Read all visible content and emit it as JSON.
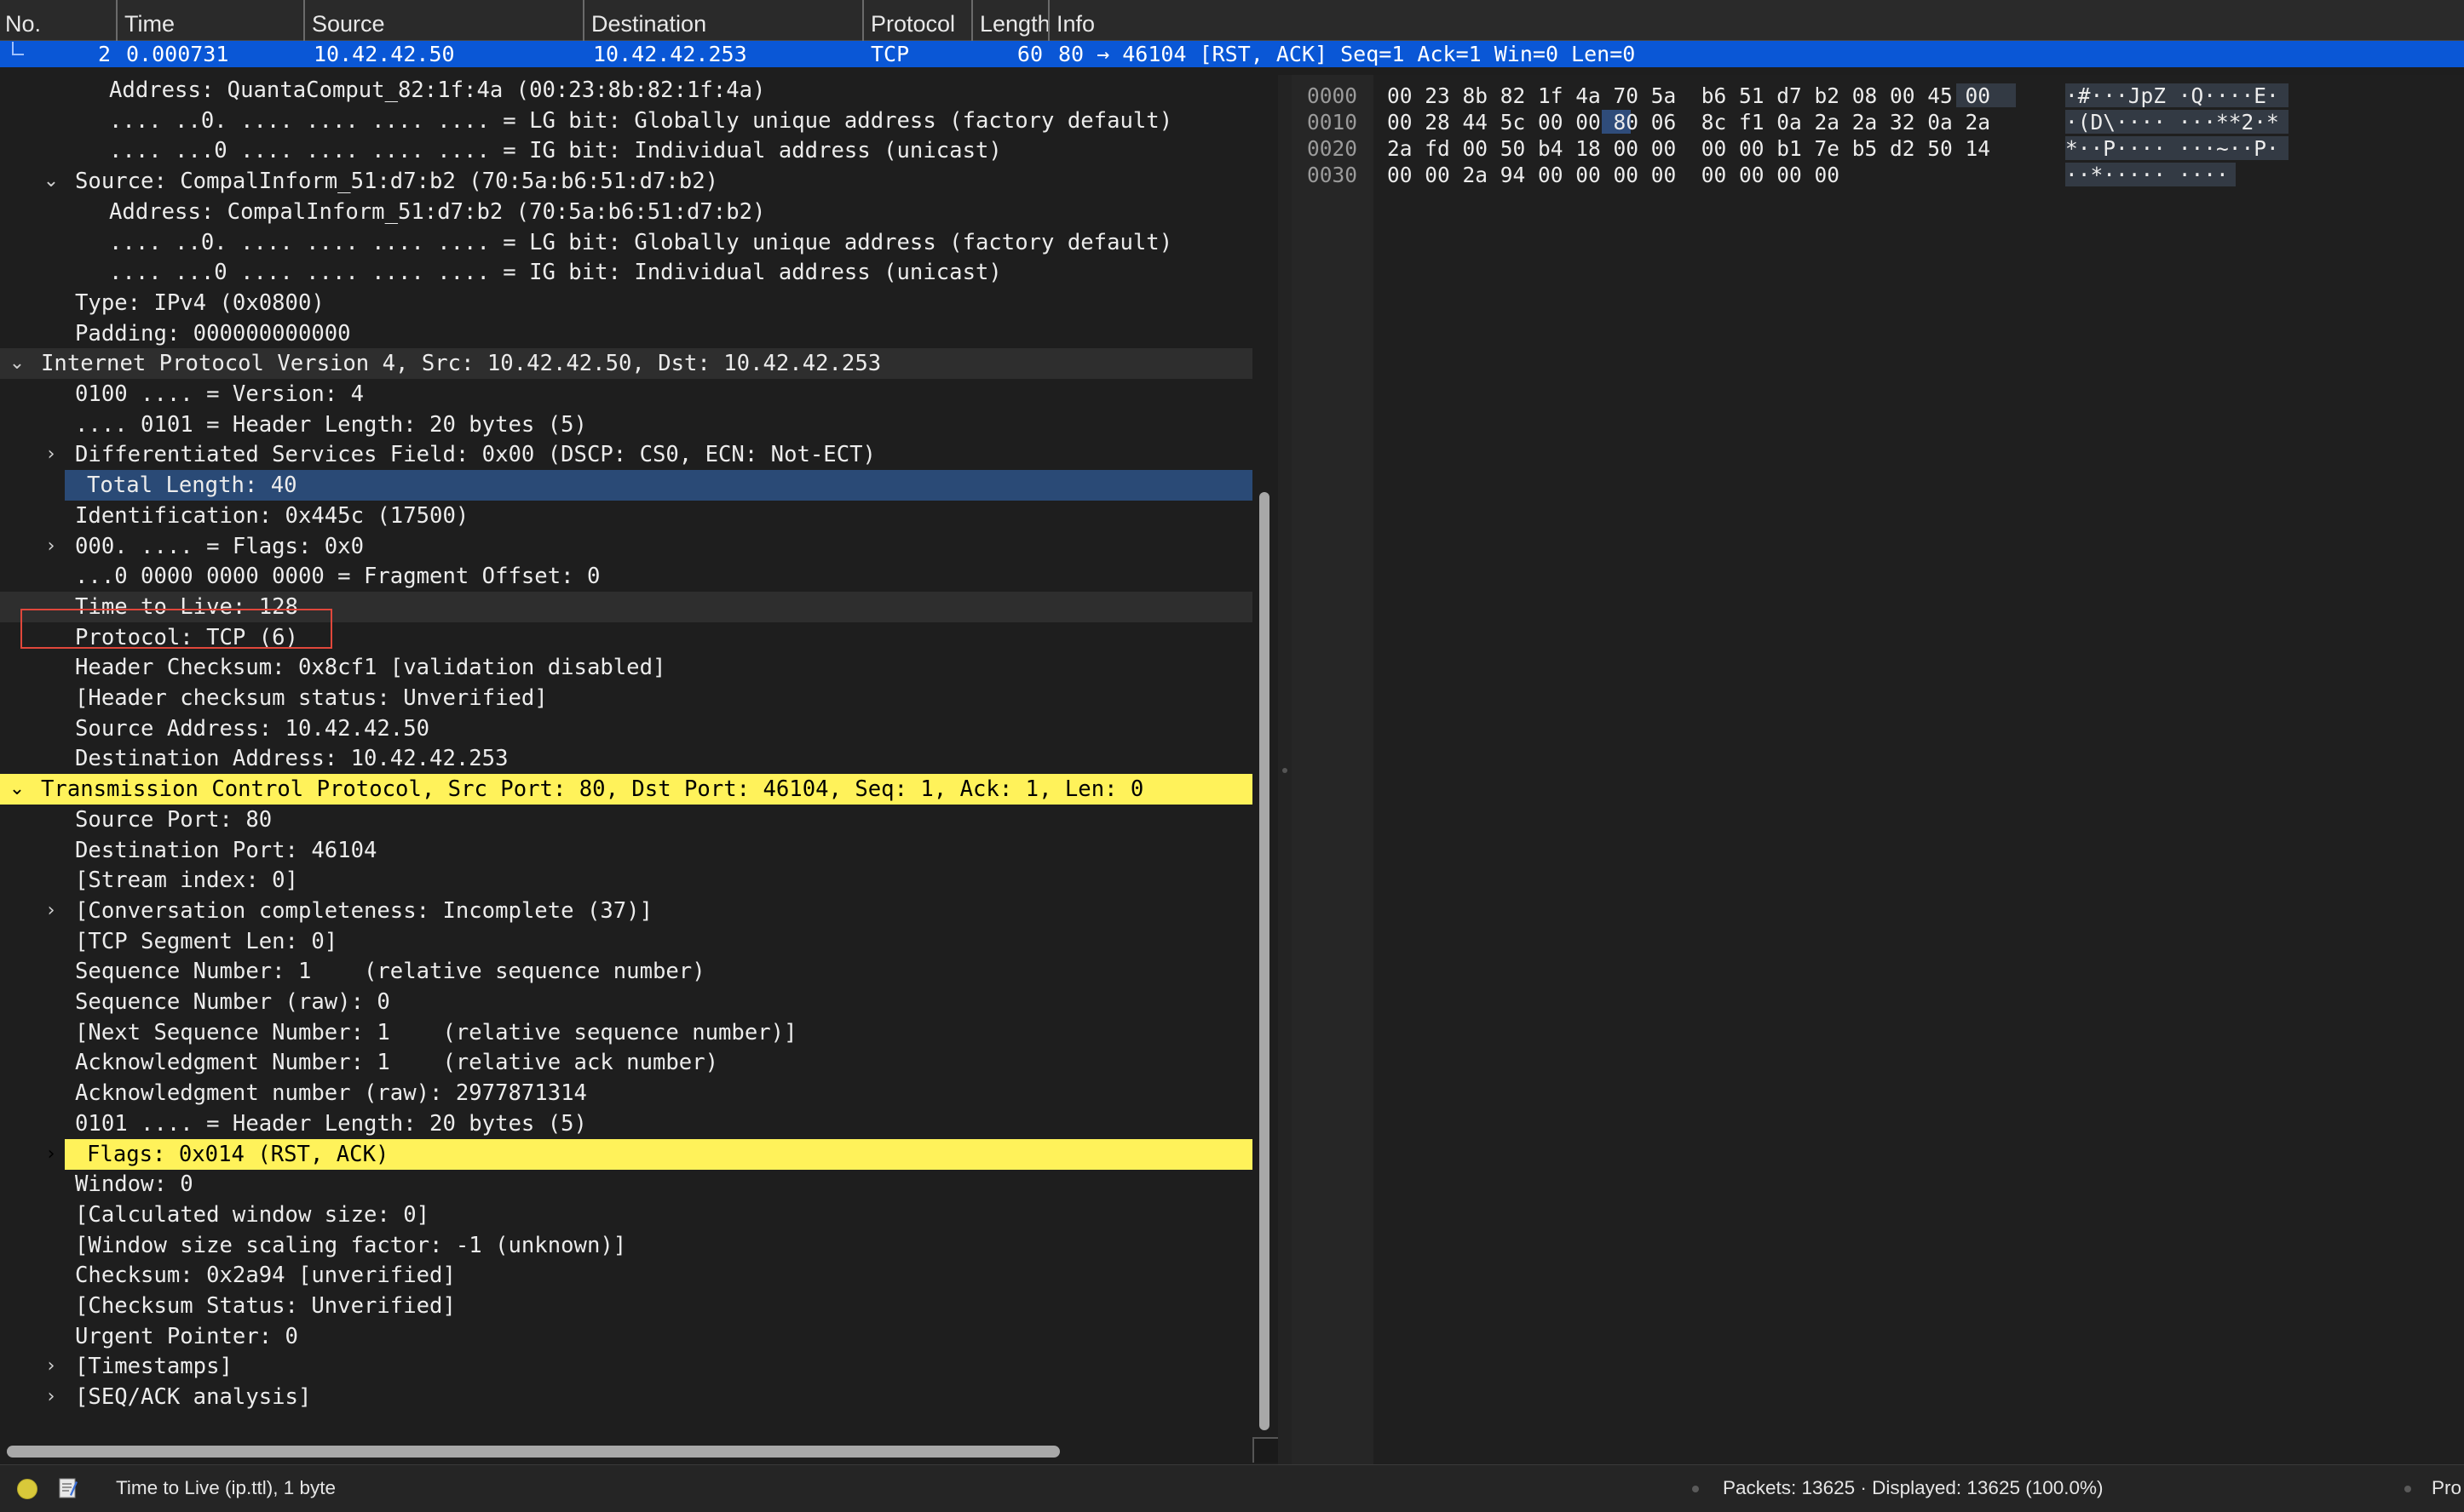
{
  "packet_list": {
    "columns": [
      "No.",
      "Time",
      "Source",
      "Destination",
      "Protocol",
      "Length",
      "Info"
    ],
    "selected_row": {
      "no": "2",
      "time": "0.000731",
      "source": "10.42.42.50",
      "destination": "10.42.42.253",
      "protocol": "TCP",
      "length": "60",
      "info": "80 → 46104 [RST, ACK] Seq=1 Ack=1 Win=0 Len=0"
    }
  },
  "details": {
    "rows": [
      "Address: QuantaComput_82:1f:4a (00:23:8b:82:1f:4a)",
      ".... ..0. .... .... .... .... = LG bit: Globally unique address (factory default)",
      ".... ...0 .... .... .... .... = IG bit: Individual address (unicast)",
      "Source: CompalInform_51:d7:b2 (70:5a:b6:51:d7:b2)",
      "Address: CompalInform_51:d7:b2 (70:5a:b6:51:d7:b2)",
      ".... ..0. .... .... .... .... = LG bit: Globally unique address (factory default)",
      ".... ...0 .... .... .... .... = IG bit: Individual address (unicast)",
      "Type: IPv4 (0x0800)",
      "Padding: 000000000000",
      "Internet Protocol Version 4, Src: 10.42.42.50, Dst: 10.42.42.253",
      "0100 .... = Version: 4",
      ".... 0101 = Header Length: 20 bytes (5)",
      "Differentiated Services Field: 0x00 (DSCP: CS0, ECN: Not-ECT)",
      "Total Length: 40",
      "Identification: 0x445c (17500)",
      "000. .... = Flags: 0x0",
      "...0 0000 0000 0000 = Fragment Offset: 0",
      "Time to Live: 128",
      "Protocol: TCP (6)",
      "Header Checksum: 0x8cf1 [validation disabled]",
      "[Header checksum status: Unverified]",
      "Source Address: 10.42.42.50",
      "Destination Address: 10.42.42.253",
      "Transmission Control Protocol, Src Port: 80, Dst Port: 46104, Seq: 1, Ack: 1, Len: 0",
      "Source Port: 80",
      "Destination Port: 46104",
      "[Stream index: 0]",
      "[Conversation completeness: Incomplete (37)]",
      "[TCP Segment Len: 0]",
      "Sequence Number: 1    (relative sequence number)",
      "Sequence Number (raw): 0",
      "[Next Sequence Number: 1    (relative sequence number)]",
      "Acknowledgment Number: 1    (relative ack number)",
      "Acknowledgment number (raw): 2977871314",
      "0101 .... = Header Length: 20 bytes (5)",
      "Flags: 0x014 (RST, ACK)",
      "Window: 0",
      "[Calculated window size: 0]",
      "[Window size scaling factor: -1 (unknown)]",
      "Checksum: 0x2a94 [unverified]",
      "[Checksum Status: Unverified]",
      "Urgent Pointer: 0",
      "[Timestamps]",
      "[SEQ/ACK analysis]"
    ],
    "arrows": {
      "expanded": "⌄",
      "collapsed": "›"
    }
  },
  "bytes": {
    "offsets": [
      "0000",
      "0010",
      "0020",
      "0030"
    ],
    "hex": [
      "00 23 8b 82 1f 4a 70 5a  b6 51 d7 b2 08 00 45 00",
      "00 28 44 5c 00 00 80 06  8c f1 0a 2a 2a 32 0a 2a",
      "2a fd 00 50 b4 18 00 00  00 00 b1 7e b5 d2 50 14",
      "00 00 2a 94 00 00 00 00  00 00 00 00"
    ],
    "ascii": [
      "·#···JpZ ·Q····E·",
      "·(D\\···· ···**2·*",
      "*··P···· ···~··P·",
      "··*····· ····"
    ]
  },
  "status_bar": {
    "field_info": "Time to Live (ip.ttl), 1 byte",
    "packets": "Packets: 13625 · Displayed: 13625 (100.0%)",
    "profile": "Pro"
  },
  "colors": {
    "selection_blue": "#0a57d6",
    "field_highlight": "#2a4a76",
    "protocol_highlight": "#fff25a",
    "annotation_box": "#e0473b"
  }
}
